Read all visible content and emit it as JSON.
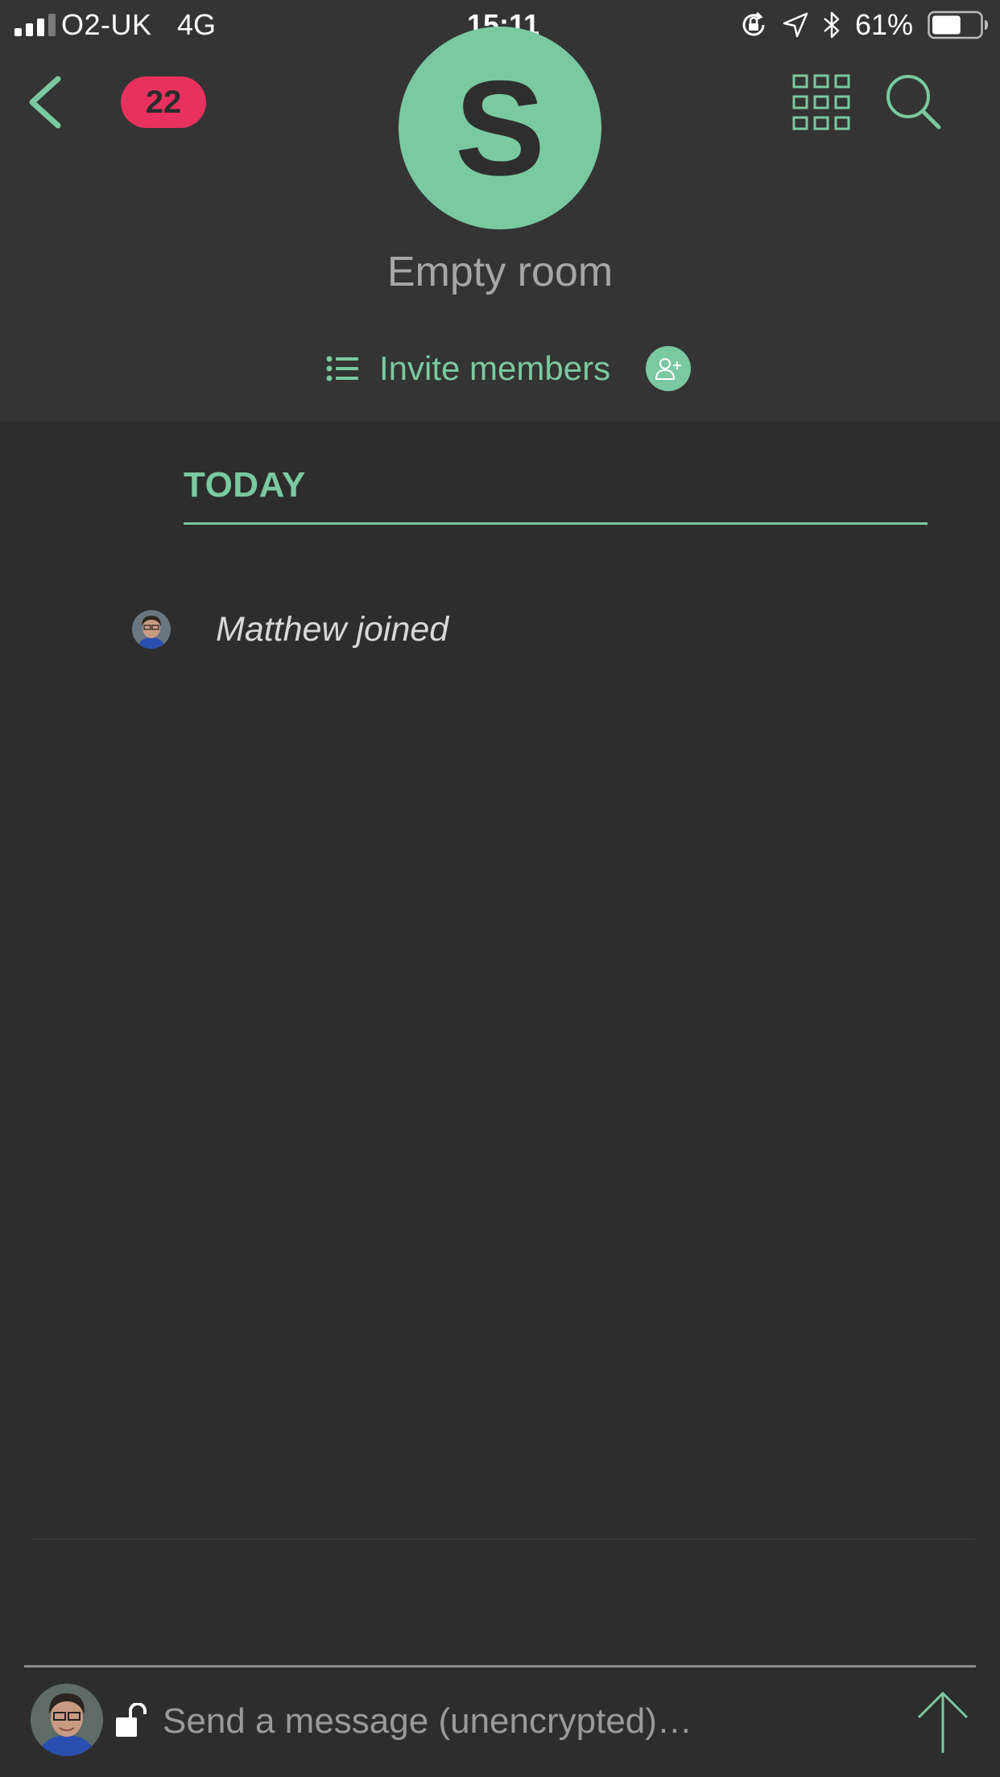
{
  "status_bar": {
    "carrier": "O2-UK",
    "network": "4G",
    "time": "15:11",
    "battery_percent": "61%",
    "battery_level": 0.61
  },
  "header": {
    "unread_count": "22",
    "room_avatar_letter": "S",
    "room_name": "Empty room",
    "invite_label": "Invite members"
  },
  "timeline": {
    "date_separator": "TODAY",
    "events": [
      {
        "text": "Matthew joined"
      }
    ]
  },
  "composer": {
    "placeholder": "Send a message (unencrypted)…"
  },
  "colors": {
    "accent": "#7ac9a1",
    "badge": "#e8315e",
    "header_bg": "#343434",
    "timeline_bg": "#2d2d2d"
  }
}
